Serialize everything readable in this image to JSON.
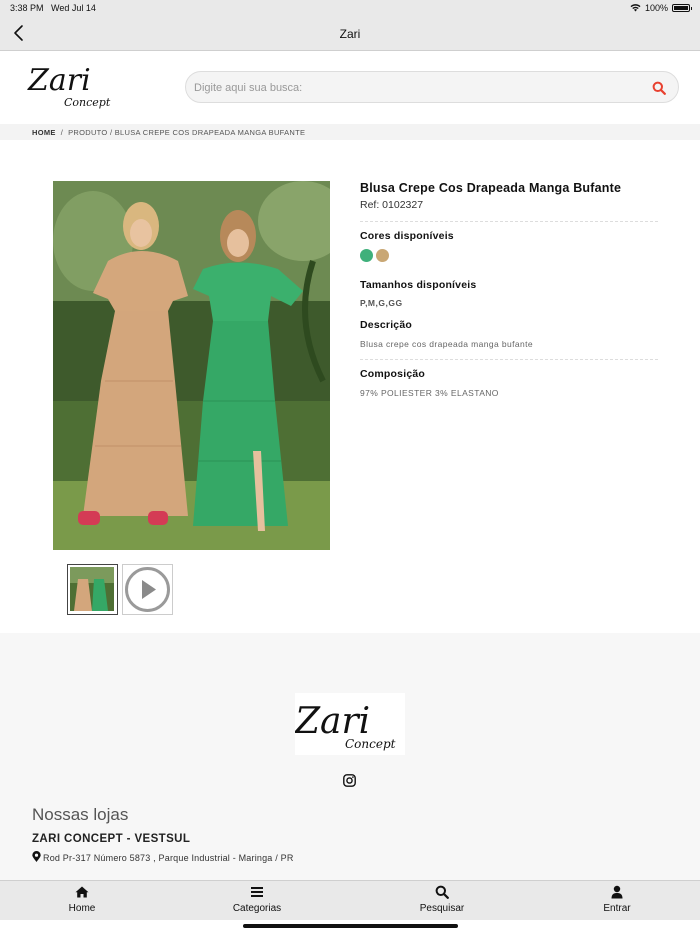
{
  "status_bar": {
    "time": "3:38 PM",
    "date": "Wed Jul 14",
    "battery": "100%"
  },
  "nav": {
    "title": "Zari"
  },
  "header": {
    "logo_text": "Zari Concept",
    "search_placeholder": "Digite aqui sua busca:"
  },
  "breadcrumb": {
    "home": "HOME",
    "separator": "/",
    "path": "PRODUTO / BLUSA CREPE COS DRAPEADA MANGA BUFANTE"
  },
  "product": {
    "title": "Blusa Crepe Cos Drapeada Manga Bufante",
    "ref": "Ref: 0102327",
    "colors_title": "Cores disponíveis",
    "colors": [
      "#3fb07b",
      "#c9a774"
    ],
    "sizes_title": "Tamanhos disponíveis",
    "sizes": "P,M,G,GG",
    "description_title": "Descrição",
    "description": "Blusa crepe cos drapeada manga bufante",
    "composition_title": "Composição",
    "composition": "97% POLIESTER 3% ELASTANO"
  },
  "footer": {
    "logo_text": "Zari Concept",
    "stores_title": "Nossas lojas",
    "store_name": "ZARI CONCEPT - VESTSUL",
    "store_address": "Rod Pr-317 Número 5873 , Parque Industrial - Maringa / PR"
  },
  "tabs": [
    {
      "label": "Home",
      "icon": "home-icon"
    },
    {
      "label": "Categorias",
      "icon": "menu-icon"
    },
    {
      "label": "Pesquisar",
      "icon": "search-icon"
    },
    {
      "label": "Entrar",
      "icon": "user-icon"
    }
  ]
}
